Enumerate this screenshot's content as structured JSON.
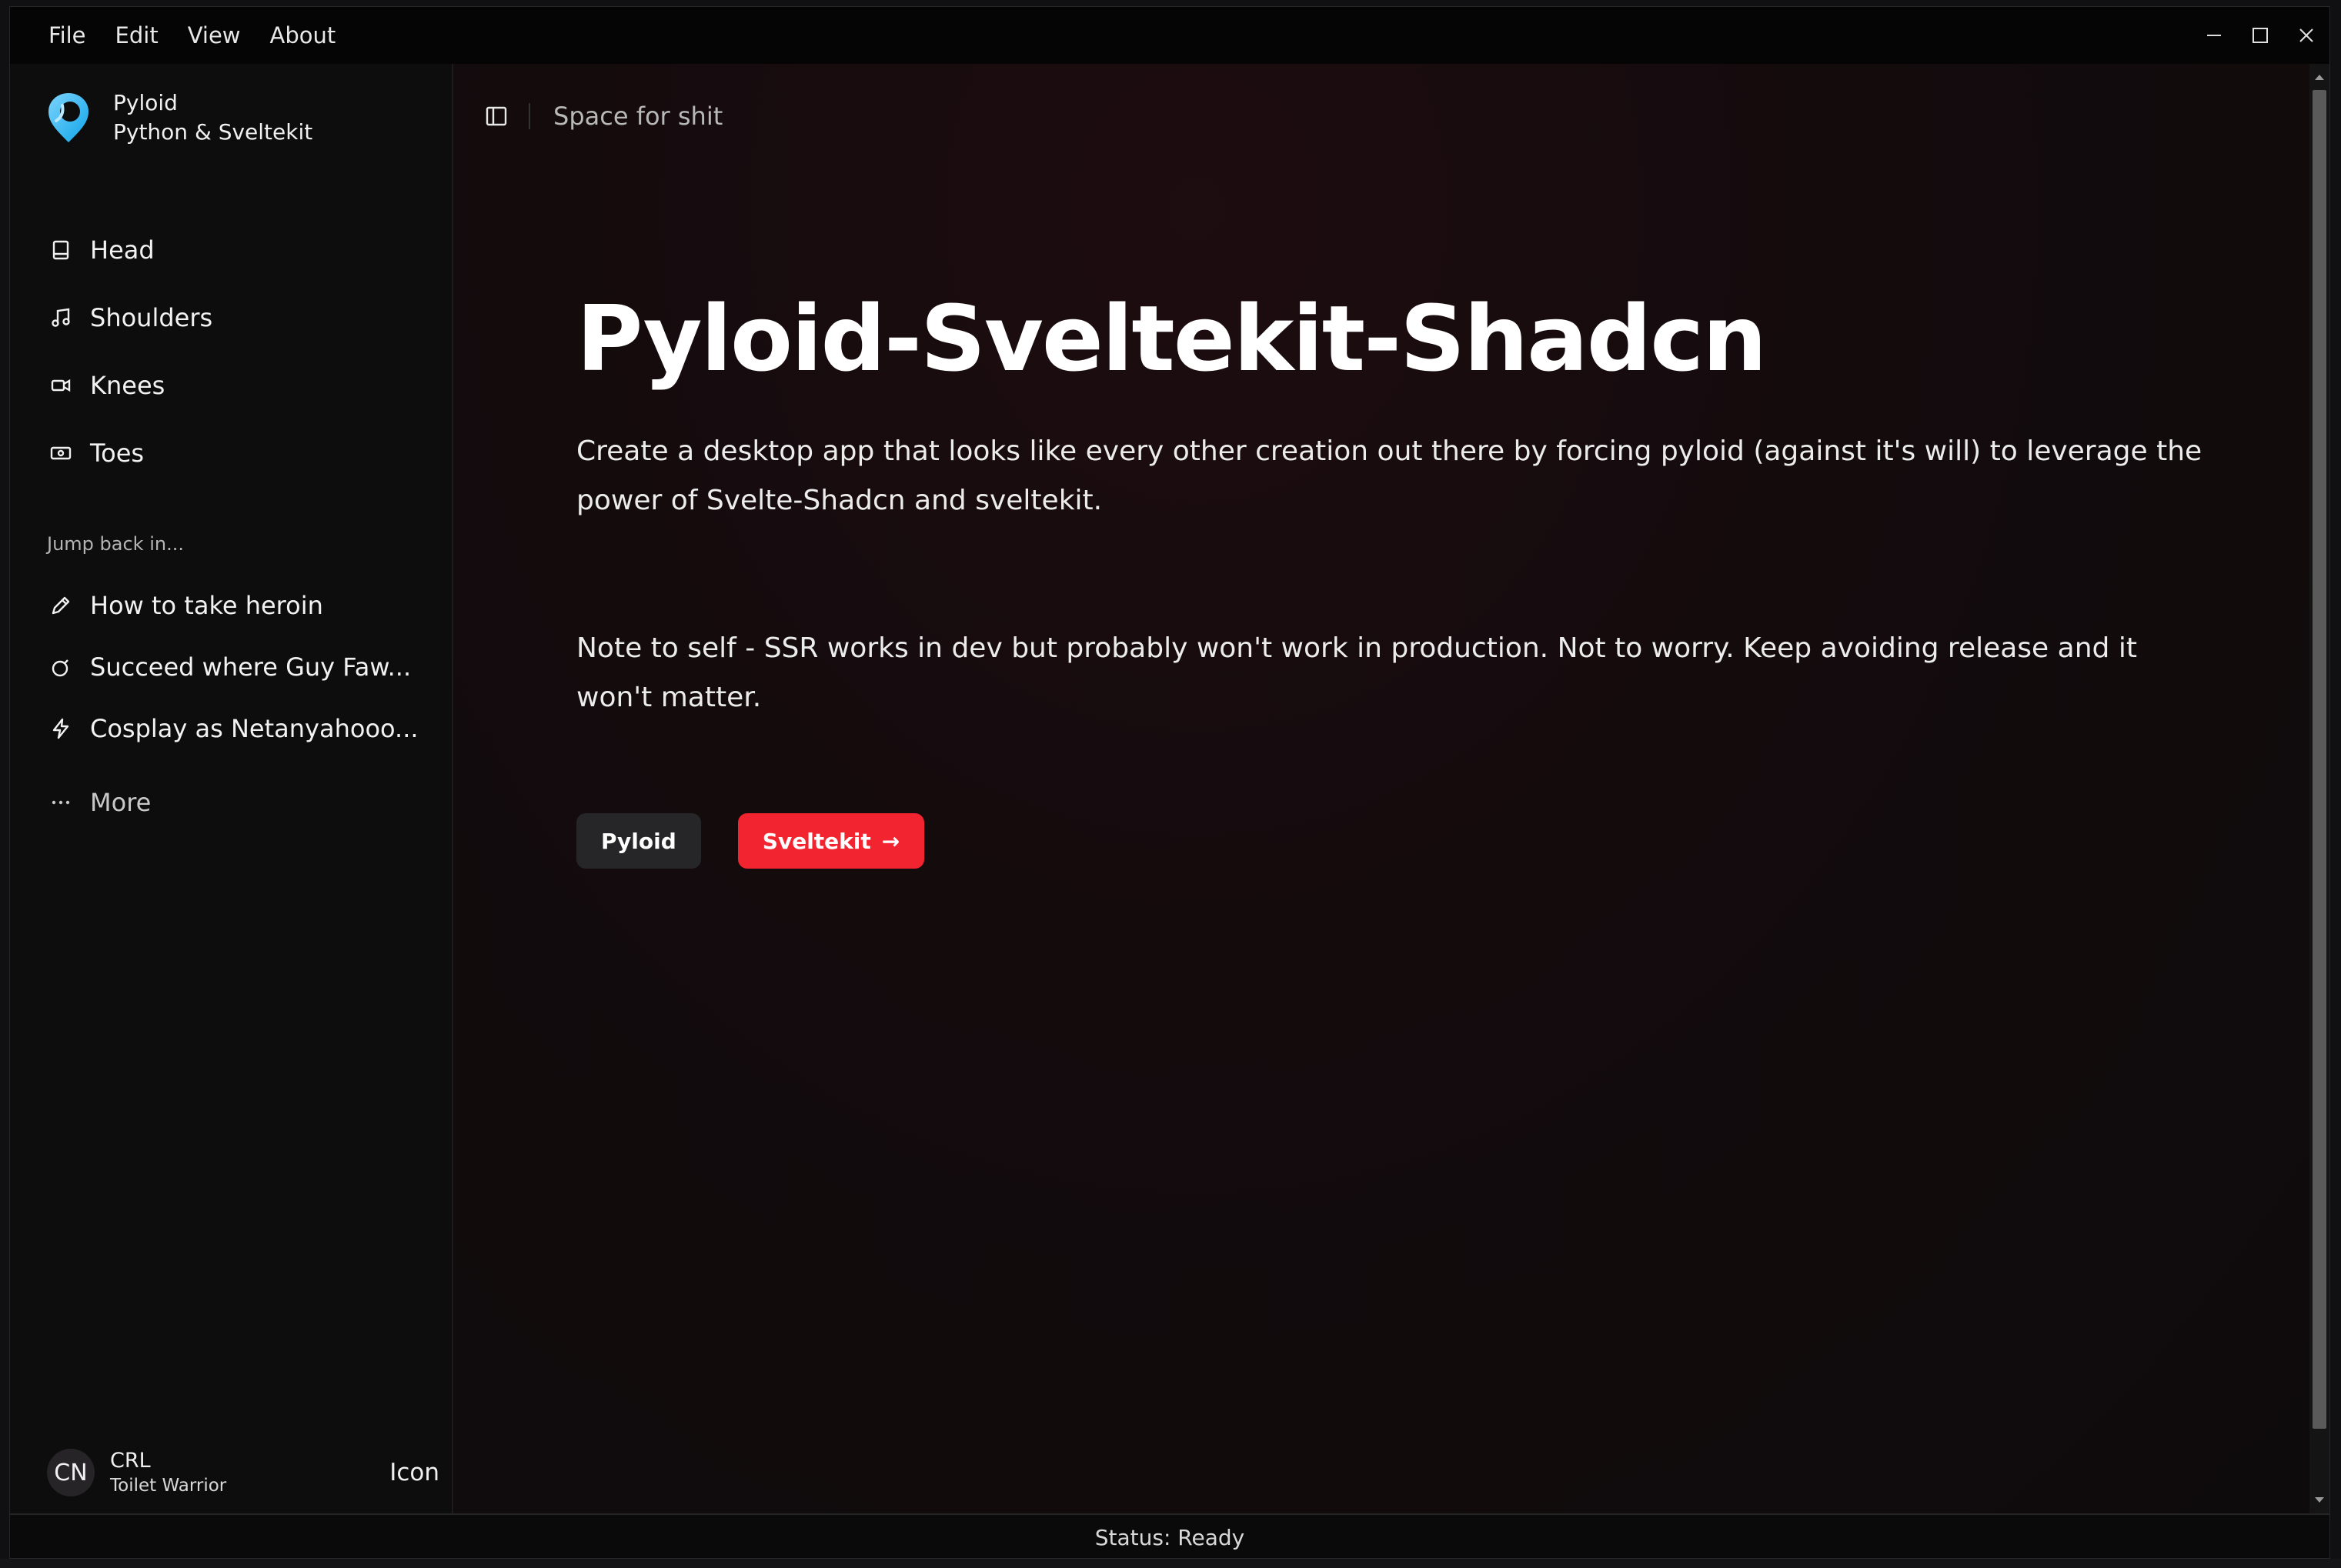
{
  "menubar": {
    "items": [
      "File",
      "Edit",
      "View",
      "About"
    ]
  },
  "sidebar": {
    "brand": {
      "name": "Pyloid",
      "subtitle": "Python & Sveltekit"
    },
    "nav": [
      {
        "label": "Head",
        "icon": "book-icon"
      },
      {
        "label": "Shoulders",
        "icon": "music-note-icon"
      },
      {
        "label": "Knees",
        "icon": "video-camera-icon"
      },
      {
        "label": "Toes",
        "icon": "banknote-icon"
      }
    ],
    "section_label": "Jump back in...",
    "recent": [
      {
        "label": "How to take heroin",
        "icon": "pen-icon"
      },
      {
        "label": "Succeed where Guy Faw...",
        "icon": "bomb-icon"
      },
      {
        "label": "Cosplay as Netanyahooo...",
        "icon": "lightning-icon"
      }
    ],
    "more_label": "More",
    "user": {
      "initials": "CN",
      "name": "CRL",
      "role": "Toilet Warrior",
      "action": "Icon"
    }
  },
  "header": {
    "title": "Space for shit"
  },
  "main": {
    "title": "Pyloid-Sveltekit-Shadcn",
    "description": "Create a desktop app that looks like every other creation out there by forcing pyloid (against it's will) to leverage the power of Svelte-Shadcn and sveltekit.",
    "note": "Note to self - SSR works in dev but probably won't work in production. Not to worry. Keep avoiding release and it won't matter.",
    "buttons": {
      "secondary": "Pyloid",
      "primary": "Sveltekit",
      "primary_arrow": "→"
    }
  },
  "status": {
    "text": "Status: Ready"
  },
  "colors": {
    "accent": "#f2242f",
    "logo": "#38bdf8"
  }
}
